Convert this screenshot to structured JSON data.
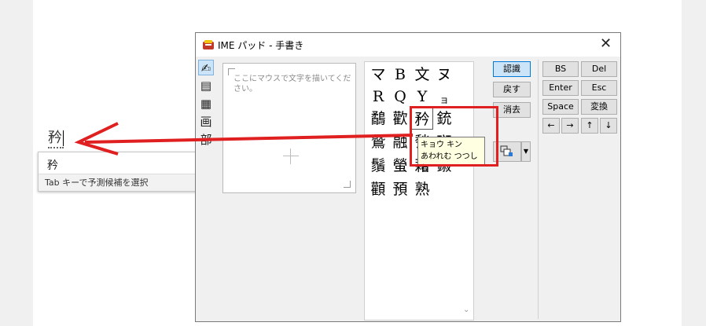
{
  "document": {
    "typed_char": "矜"
  },
  "suggestion": {
    "candidate": "矜",
    "close_glyph": "✕",
    "hint": "Tab キーで予測候補を選択"
  },
  "window": {
    "title": "IME パッド - 手書き",
    "close_glyph": "✕"
  },
  "tools": [
    {
      "name": "handwriting",
      "glyph": "✍"
    },
    {
      "name": "dictionary",
      "glyph": "▤"
    },
    {
      "name": "soft-keyboard",
      "glyph": "▦"
    },
    {
      "name": "stroke-count",
      "glyph": "画"
    },
    {
      "name": "radical",
      "glyph": "部"
    }
  ],
  "canvas": {
    "placeholder": "ここにマウスで文字を描いてください。"
  },
  "candidates": {
    "chars": [
      "マ",
      "B",
      "文",
      "ヌ",
      "R",
      "Q",
      "Y",
      "ョ",
      "鷸",
      "歡",
      "矜",
      "銃",
      "鷲",
      "融",
      "甃",
      "斑",
      "鬚",
      "螢",
      "藉",
      "鎩",
      "顴",
      "預",
      "熟"
    ]
  },
  "tooltip": {
    "line1": "キョウ キン",
    "line2": "あわれむ つつしむ"
  },
  "buttons": {
    "recognize": "認識",
    "back": "戻す",
    "erase": "消去"
  },
  "keys": {
    "bs": "BS",
    "del": "Del",
    "enter": "Enter",
    "esc": "Esc",
    "space": "Space",
    "convert": "変換",
    "left": "←",
    "right": "→",
    "up": "↑",
    "down": "↓"
  },
  "colors": {
    "annotation_red": "#e02020",
    "accent": "#0078d7"
  }
}
